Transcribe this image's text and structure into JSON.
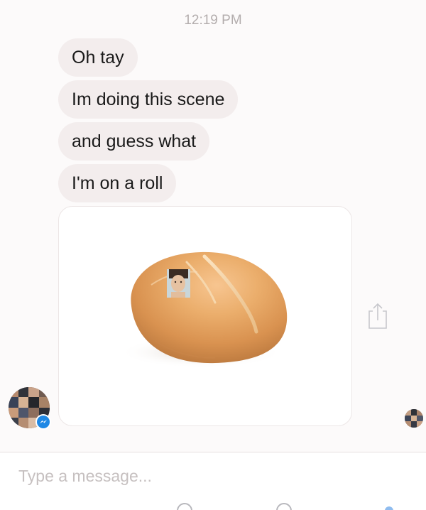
{
  "header": {
    "timestamp": "12:19 PM"
  },
  "messages": [
    {
      "text": "Oh tay"
    },
    {
      "text": "Im doing this scene"
    },
    {
      "text": "and guess what"
    },
    {
      "text": "I'm on a roll"
    }
  ],
  "attachment": {
    "icon": "bread-roll-image",
    "overlay": "face-photo"
  },
  "composer": {
    "placeholder": "Type a message..."
  },
  "colors": {
    "bubble": "#f3eded",
    "background": "#fcfafa",
    "timestamp": "#b3adad",
    "messenger_badge": "#1e88e5"
  }
}
